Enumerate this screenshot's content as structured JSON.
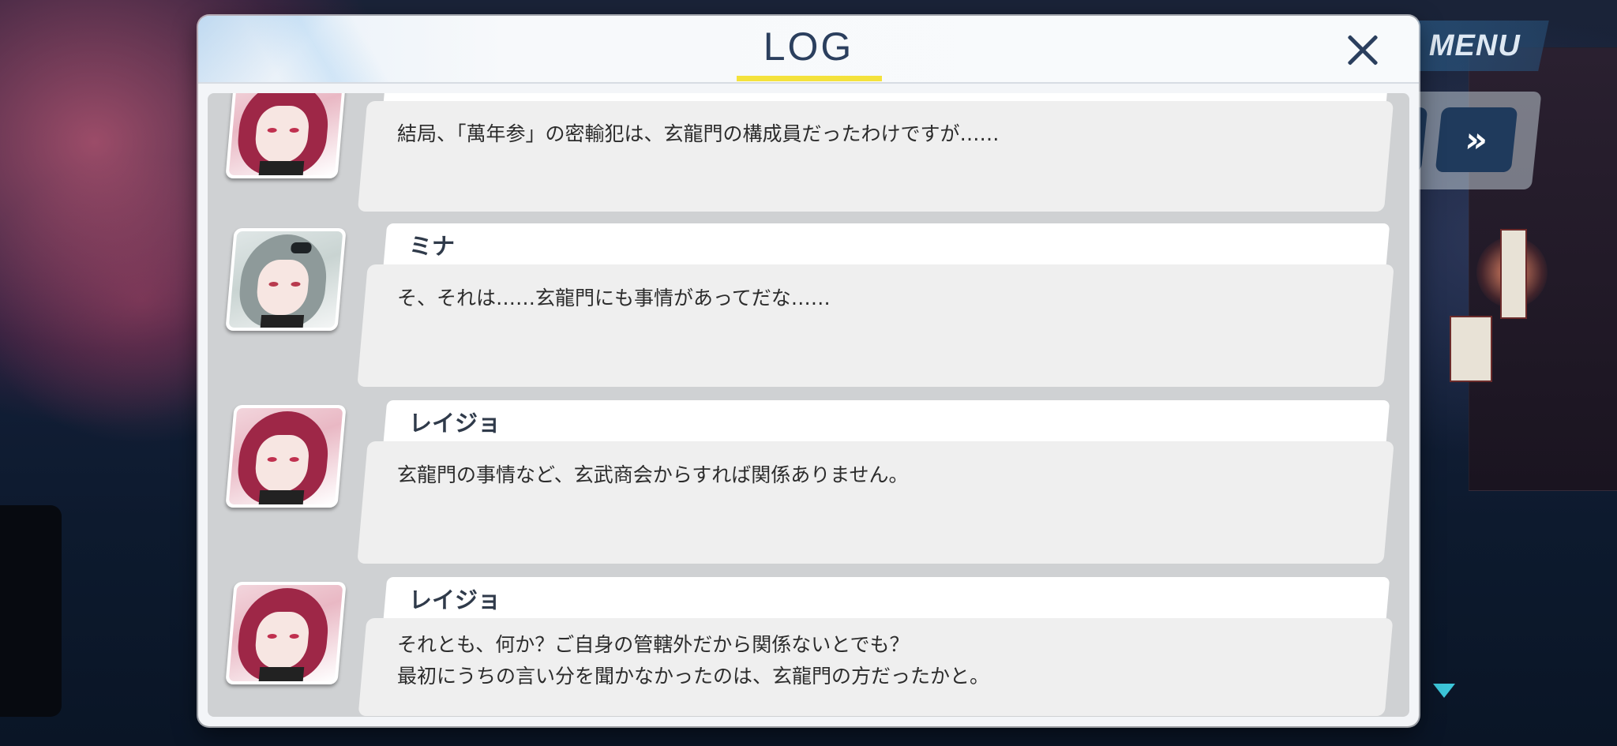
{
  "header": {
    "title": "LOG"
  },
  "top_controls": {
    "menu_label": "MENU",
    "fast_forward_glyph": "»"
  },
  "log_entries": [
    {
      "speaker": "",
      "portrait": "reijo-portrait",
      "lines": [
        "結局、「萬年参」の密輸犯は、玄龍門の構成員だったわけですが……"
      ]
    },
    {
      "speaker": "ミナ",
      "portrait": "mina-portrait",
      "lines": [
        "そ、それは……玄龍門にも事情があってだな……"
      ]
    },
    {
      "speaker": "レイジョ",
      "portrait": "reijo-portrait",
      "lines": [
        "玄龍門の事情など、玄武商会からすれば関係ありません。"
      ]
    },
    {
      "speaker": "レイジョ",
      "portrait": "reijo-portrait",
      "lines": [
        "それとも、何か？ご自身の管轄外だから関係ないとでも？",
        "最初にうちの言い分を聞かなかったのは、玄龍門の方だったかと。"
      ]
    }
  ],
  "colors": {
    "title": "#2b3f5e",
    "title_underline": "#f4e23c",
    "menu_bg": "#28507a",
    "ff_button": "#1f3a5c",
    "scroll_indicator": "#3cc5d8"
  }
}
